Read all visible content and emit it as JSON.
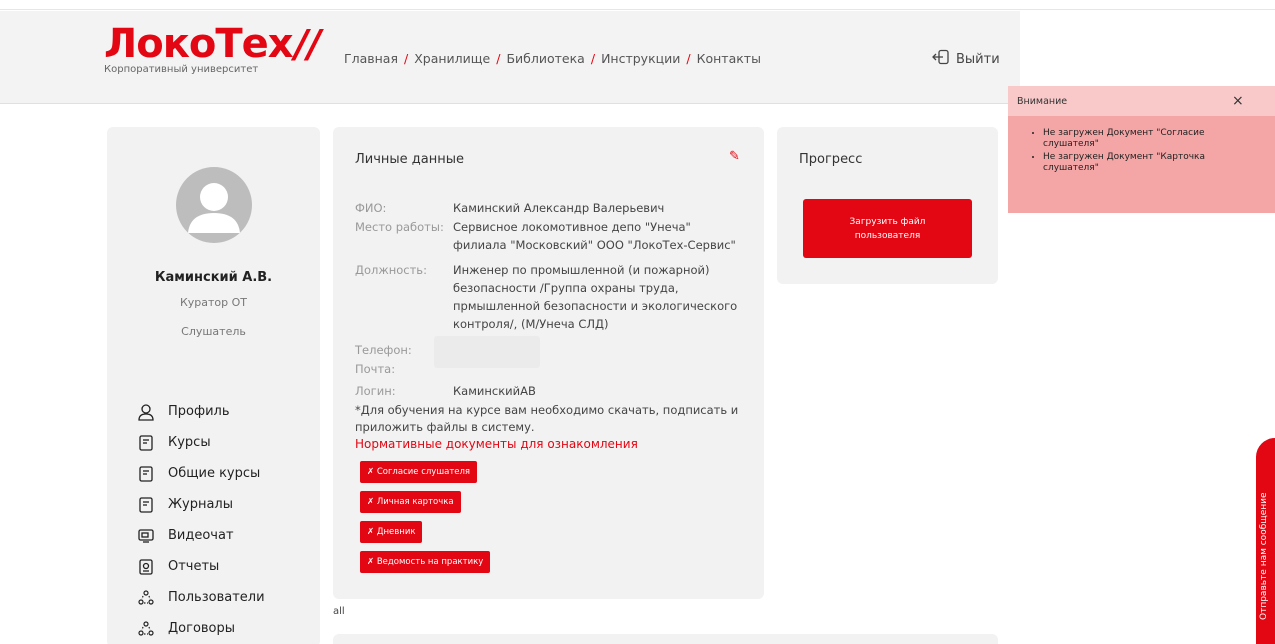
{
  "header": {
    "logo_text": "ЛокоТех",
    "logo_slash": "//",
    "logo_subtitle": "Корпоративный университет",
    "nav": [
      "Главная",
      "Хранилище",
      "Библиотека",
      "Инструкции",
      "Контакты"
    ],
    "logout": "Выйти"
  },
  "profile": {
    "name": "Каминский А.В.",
    "role1": "Куратор ОТ",
    "role2": "Слушатель"
  },
  "menu": [
    {
      "label": "Профиль",
      "icon": "user-icon"
    },
    {
      "label": "Курсы",
      "icon": "book-icon"
    },
    {
      "label": "Общие курсы",
      "icon": "book-icon"
    },
    {
      "label": "Журналы",
      "icon": "book-icon"
    },
    {
      "label": "Видеочат",
      "icon": "video-chat-icon"
    },
    {
      "label": "Отчеты",
      "icon": "report-icon"
    },
    {
      "label": "Пользователи",
      "icon": "users-icon"
    },
    {
      "label": "Договоры",
      "icon": "users-icon"
    }
  ],
  "personal": {
    "title": "Личные данные",
    "fio_label": "ФИО:",
    "fio": "Каминский Александр Валерьевич",
    "work_label": "Место работы:",
    "work": "Сервисное локомотивное депо \"Унеча\" филиала \"Московский\" ООО \"ЛокоТех-Сервис\"",
    "position_label": "Должность:",
    "position": "Инженер по промышленной (и пожарной) безопасности /Группа охраны труда, прмышленной безопасности и экологического контроля/, (М/Унеча СЛД)",
    "phone_label": "Телефон:",
    "email_label": "Почта:",
    "login_label": "Логин:",
    "login": "КаминскийАВ",
    "note": "*Для обучения на курсе вам необходимо скачать, подписать и приложить файлы в систему.",
    "docs_link": "Нормативные документы для ознакомления",
    "doc_buttons": [
      "✗ Согласие слушателя",
      "✗ Личная карточка",
      "✗ Дневник",
      "✗ Ведомость на практику"
    ],
    "all_text": "all"
  },
  "progress": {
    "title": "Прогресс",
    "upload_button": "Загрузить файл пользователя"
  },
  "alert": {
    "title": "Внимание",
    "close": "×",
    "items": [
      "Не загружен Документ \"Согласие слушателя\"",
      "Не загружен Документ \"Карточка слушателя\""
    ]
  },
  "chat": {
    "label": "Отправьте нам сообщение"
  },
  "colors": {
    "accent": "#e30613",
    "alert_bg": "#f4a6a6",
    "card_bg": "#f2f2f2"
  }
}
